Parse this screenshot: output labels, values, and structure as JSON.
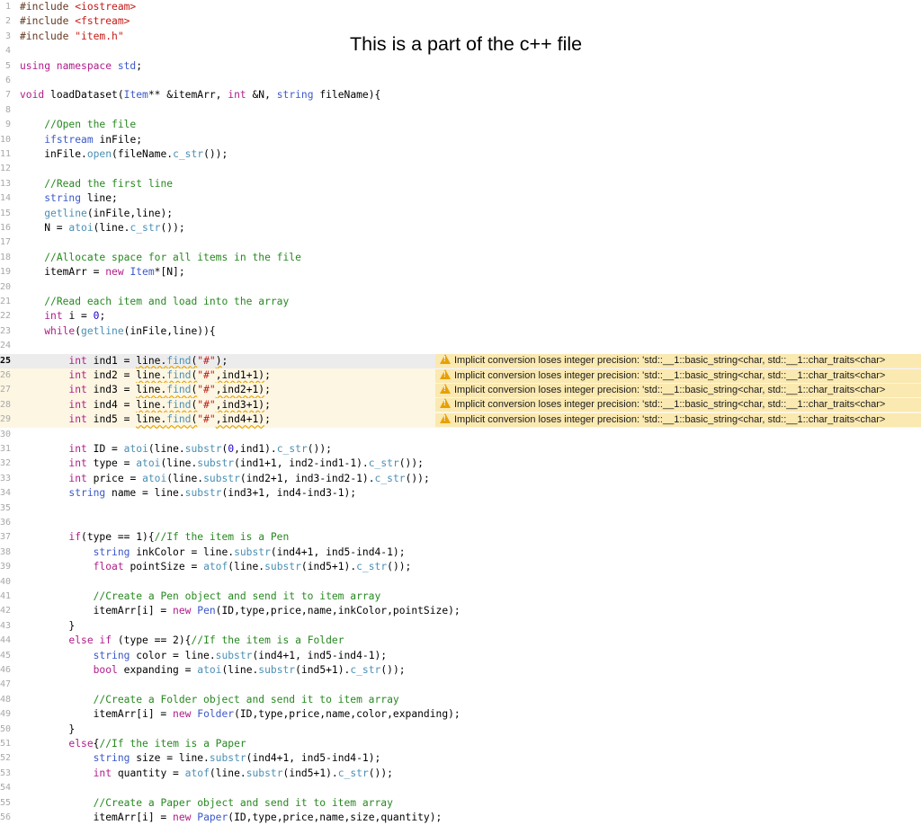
{
  "caption": "This is a part of the c++ file",
  "warning_text": "Implicit conversion loses integer precision: 'std::__1::basic_string<char, std::__1::char_traits<char>",
  "colors": {
    "keyword": "#b01c8a",
    "type": "#3b58c9",
    "function": "#4a8fb4",
    "comment": "#278820",
    "string": "#c41a16",
    "number": "#1c00cf",
    "warning_bg": "#fae9b0",
    "warning_icon": "#e8a000"
  },
  "lines": [
    {
      "n": "1",
      "tokens": [
        [
          "pp",
          "#include "
        ],
        [
          "st",
          "<iostream>"
        ]
      ]
    },
    {
      "n": "2",
      "tokens": [
        [
          "pp",
          "#include "
        ],
        [
          "st",
          "<fstream>"
        ]
      ]
    },
    {
      "n": "3",
      "tokens": [
        [
          "pp",
          "#include "
        ],
        [
          "st",
          "\"item.h\""
        ]
      ]
    },
    {
      "n": "4",
      "tokens": []
    },
    {
      "n": "5",
      "tokens": [
        [
          "kw",
          "using namespace "
        ],
        [
          "tp",
          "std"
        ],
        [
          "",
          "; "
        ]
      ]
    },
    {
      "n": "6",
      "tokens": []
    },
    {
      "n": "7",
      "tokens": [
        [
          "kw",
          "void "
        ],
        [
          "",
          "loadDataset("
        ],
        [
          "tp",
          "Item"
        ],
        [
          "",
          "** &itemArr, "
        ],
        [
          "kw",
          "int "
        ],
        [
          "",
          "&N, "
        ],
        [
          "tp",
          "string "
        ],
        [
          "",
          "fileName){"
        ]
      ]
    },
    {
      "n": "8",
      "tokens": []
    },
    {
      "n": "9",
      "tokens": [
        [
          "",
          "    "
        ],
        [
          "cm",
          "//Open the file"
        ]
      ]
    },
    {
      "n": "10",
      "tokens": [
        [
          "",
          "    "
        ],
        [
          "tp",
          "ifstream "
        ],
        [
          "",
          "inFile;"
        ]
      ]
    },
    {
      "n": "11",
      "tokens": [
        [
          "",
          "    inFile."
        ],
        [
          "fn",
          "open"
        ],
        [
          "",
          "(fileName."
        ],
        [
          "fn",
          "c_str"
        ],
        [
          "",
          "());"
        ]
      ]
    },
    {
      "n": "12",
      "tokens": []
    },
    {
      "n": "13",
      "tokens": [
        [
          "",
          "    "
        ],
        [
          "cm",
          "//Read the first line"
        ]
      ]
    },
    {
      "n": "14",
      "tokens": [
        [
          "",
          "    "
        ],
        [
          "tp",
          "string "
        ],
        [
          "",
          "line;"
        ]
      ]
    },
    {
      "n": "15",
      "tokens": [
        [
          "",
          "    "
        ],
        [
          "fn",
          "getline"
        ],
        [
          "",
          "(inFile,line);"
        ]
      ]
    },
    {
      "n": "16",
      "tokens": [
        [
          "",
          "    N = "
        ],
        [
          "fn",
          "atoi"
        ],
        [
          "",
          "(line."
        ],
        [
          "fn",
          "c_str"
        ],
        [
          "",
          "());"
        ]
      ]
    },
    {
      "n": "17",
      "tokens": []
    },
    {
      "n": "18",
      "tokens": [
        [
          "",
          "    "
        ],
        [
          "cm",
          "//Allocate space for all items in the file"
        ]
      ]
    },
    {
      "n": "19",
      "tokens": [
        [
          "",
          "    itemArr = "
        ],
        [
          "kw",
          "new "
        ],
        [
          "tp",
          "Item"
        ],
        [
          "",
          "*[N];"
        ]
      ]
    },
    {
      "n": "20",
      "tokens": []
    },
    {
      "n": "21",
      "tokens": [
        [
          "",
          "    "
        ],
        [
          "cm",
          "//Read each item and load into the array"
        ]
      ]
    },
    {
      "n": "22",
      "tokens": [
        [
          "",
          "    "
        ],
        [
          "kw",
          "int "
        ],
        [
          "",
          "i = "
        ],
        [
          "nm",
          "0"
        ],
        [
          "",
          ";"
        ]
      ]
    },
    {
      "n": "23",
      "tokens": [
        [
          "",
          "    "
        ],
        [
          "kw",
          "while"
        ],
        [
          "",
          "("
        ],
        [
          "fn",
          "getline"
        ],
        [
          "",
          "(inFile,line)){"
        ]
      ]
    },
    {
      "n": "24",
      "tokens": []
    },
    {
      "n": "25",
      "cur": true,
      "warn": true,
      "tokens": [
        [
          "",
          "        "
        ],
        [
          "kw",
          "int "
        ],
        [
          "",
          "ind1 = "
        ],
        [
          "u",
          "line."
        ],
        [
          "fnu",
          "find"
        ],
        [
          "u",
          "("
        ],
        [
          "st",
          "\"#\""
        ],
        [
          "u",
          ")"
        ],
        [
          "",
          ";"
        ]
      ]
    },
    {
      "n": "26",
      "warn": true,
      "tokens": [
        [
          "",
          "        "
        ],
        [
          "kw",
          "int "
        ],
        [
          "",
          "ind2 = "
        ],
        [
          "u",
          "line."
        ],
        [
          "fnu",
          "find"
        ],
        [
          "u",
          "("
        ],
        [
          "st",
          "\"#\""
        ],
        [
          "u",
          ",ind1+1)"
        ],
        [
          "",
          ";"
        ]
      ]
    },
    {
      "n": "27",
      "warn": true,
      "tokens": [
        [
          "",
          "        "
        ],
        [
          "kw",
          "int "
        ],
        [
          "",
          "ind3 = "
        ],
        [
          "u",
          "line."
        ],
        [
          "fnu",
          "find"
        ],
        [
          "u",
          "("
        ],
        [
          "st",
          "\"#\""
        ],
        [
          "u",
          ",ind2+1)"
        ],
        [
          "",
          ";"
        ]
      ]
    },
    {
      "n": "28",
      "warn": true,
      "tokens": [
        [
          "",
          "        "
        ],
        [
          "kw",
          "int "
        ],
        [
          "",
          "ind4 = "
        ],
        [
          "u",
          "line."
        ],
        [
          "fnu",
          "find"
        ],
        [
          "u",
          "("
        ],
        [
          "st",
          "\"#\""
        ],
        [
          "u",
          ",ind3+1)"
        ],
        [
          "",
          ";"
        ]
      ]
    },
    {
      "n": "29",
      "warn": true,
      "tokens": [
        [
          "",
          "        "
        ],
        [
          "kw",
          "int "
        ],
        [
          "",
          "ind5 = "
        ],
        [
          "u",
          "line."
        ],
        [
          "fnu",
          "find"
        ],
        [
          "u",
          "("
        ],
        [
          "st",
          "\"#\""
        ],
        [
          "u",
          ",ind4+1)"
        ],
        [
          "",
          ";"
        ]
      ]
    },
    {
      "n": "30",
      "tokens": []
    },
    {
      "n": "31",
      "tokens": [
        [
          "",
          "        "
        ],
        [
          "kw",
          "int "
        ],
        [
          "",
          "ID = "
        ],
        [
          "fn",
          "atoi"
        ],
        [
          "",
          "(line."
        ],
        [
          "fn",
          "substr"
        ],
        [
          "",
          "("
        ],
        [
          "nm",
          "0"
        ],
        [
          "",
          ",ind1)."
        ],
        [
          "fn",
          "c_str"
        ],
        [
          "",
          "());"
        ]
      ]
    },
    {
      "n": "32",
      "tokens": [
        [
          "",
          "        "
        ],
        [
          "kw",
          "int "
        ],
        [
          "",
          "type = "
        ],
        [
          "fn",
          "atoi"
        ],
        [
          "",
          "(line."
        ],
        [
          "fn",
          "substr"
        ],
        [
          "",
          "(ind1+1, ind2-ind1-1)."
        ],
        [
          "fn",
          "c_str"
        ],
        [
          "",
          "());"
        ]
      ]
    },
    {
      "n": "33",
      "tokens": [
        [
          "",
          "        "
        ],
        [
          "kw",
          "int "
        ],
        [
          "",
          "price = "
        ],
        [
          "fn",
          "atoi"
        ],
        [
          "",
          "(line."
        ],
        [
          "fn",
          "substr"
        ],
        [
          "",
          "(ind2+1, ind3-ind2-1)."
        ],
        [
          "fn",
          "c_str"
        ],
        [
          "",
          "());"
        ]
      ]
    },
    {
      "n": "34",
      "tokens": [
        [
          "",
          "        "
        ],
        [
          "tp",
          "string "
        ],
        [
          "",
          "name = line."
        ],
        [
          "fn",
          "substr"
        ],
        [
          "",
          "(ind3+1, ind4-ind3-1);"
        ]
      ]
    },
    {
      "n": "35",
      "tokens": []
    },
    {
      "n": "36",
      "tokens": []
    },
    {
      "n": "37",
      "tokens": [
        [
          "",
          "        "
        ],
        [
          "kw",
          "if"
        ],
        [
          "",
          "(type == 1){"
        ],
        [
          "cm",
          "//If the item is a Pen"
        ]
      ]
    },
    {
      "n": "38",
      "tokens": [
        [
          "",
          "            "
        ],
        [
          "tp",
          "string "
        ],
        [
          "",
          "inkColor = line."
        ],
        [
          "fn",
          "substr"
        ],
        [
          "",
          "(ind4+1, ind5-ind4-1);"
        ]
      ]
    },
    {
      "n": "39",
      "tokens": [
        [
          "",
          "            "
        ],
        [
          "kw",
          "float "
        ],
        [
          "",
          "pointSize = "
        ],
        [
          "fn",
          "atof"
        ],
        [
          "",
          "(line."
        ],
        [
          "fn",
          "substr"
        ],
        [
          "",
          "(ind5+1)."
        ],
        [
          "fn",
          "c_str"
        ],
        [
          "",
          "());"
        ]
      ]
    },
    {
      "n": "40",
      "tokens": []
    },
    {
      "n": "41",
      "tokens": [
        [
          "",
          "            "
        ],
        [
          "cm",
          "//Create a Pen object and send it to item array"
        ]
      ]
    },
    {
      "n": "42",
      "tokens": [
        [
          "",
          "            itemArr[i] = "
        ],
        [
          "kw",
          "new "
        ],
        [
          "tp",
          "Pen"
        ],
        [
          "",
          "(ID,type,price,name,inkColor,pointSize);"
        ]
      ]
    },
    {
      "n": "43",
      "tokens": [
        [
          "",
          "        }"
        ]
      ]
    },
    {
      "n": "44",
      "tokens": [
        [
          "",
          "        "
        ],
        [
          "kw",
          "else if "
        ],
        [
          "",
          "(type == 2){"
        ],
        [
          "cm",
          "//If the item is a Folder"
        ]
      ]
    },
    {
      "n": "45",
      "tokens": [
        [
          "",
          "            "
        ],
        [
          "tp",
          "string "
        ],
        [
          "",
          "color = line."
        ],
        [
          "fn",
          "substr"
        ],
        [
          "",
          "(ind4+1, ind5-ind4-1);"
        ]
      ]
    },
    {
      "n": "46",
      "tokens": [
        [
          "",
          "            "
        ],
        [
          "kw",
          "bool "
        ],
        [
          "",
          "expanding = "
        ],
        [
          "fn",
          "atoi"
        ],
        [
          "",
          "(line."
        ],
        [
          "fn",
          "substr"
        ],
        [
          "",
          "(ind5+1)."
        ],
        [
          "fn",
          "c_str"
        ],
        [
          "",
          "());"
        ]
      ]
    },
    {
      "n": "47",
      "tokens": []
    },
    {
      "n": "48",
      "tokens": [
        [
          "",
          "            "
        ],
        [
          "cm",
          "//Create a Folder object and send it to item array"
        ]
      ]
    },
    {
      "n": "49",
      "tokens": [
        [
          "",
          "            itemArr[i] = "
        ],
        [
          "kw",
          "new "
        ],
        [
          "tp",
          "Folder"
        ],
        [
          "",
          "(ID,type,price,name,color,expanding);"
        ]
      ]
    },
    {
      "n": "50",
      "tokens": [
        [
          "",
          "        }"
        ]
      ]
    },
    {
      "n": "51",
      "tokens": [
        [
          "",
          "        "
        ],
        [
          "kw",
          "else"
        ],
        [
          "",
          "{"
        ],
        [
          "cm",
          "//If the item is a Paper"
        ]
      ]
    },
    {
      "n": "52",
      "tokens": [
        [
          "",
          "            "
        ],
        [
          "tp",
          "string "
        ],
        [
          "",
          "size = line."
        ],
        [
          "fn",
          "substr"
        ],
        [
          "",
          "(ind4+1, ind5-ind4-1);"
        ]
      ]
    },
    {
      "n": "53",
      "tokens": [
        [
          "",
          "            "
        ],
        [
          "kw",
          "int "
        ],
        [
          "",
          "quantity = "
        ],
        [
          "fn",
          "atof"
        ],
        [
          "",
          "(line."
        ],
        [
          "fn",
          "substr"
        ],
        [
          "",
          "(ind5+1)."
        ],
        [
          "fn",
          "c_str"
        ],
        [
          "",
          "());"
        ]
      ]
    },
    {
      "n": "54",
      "tokens": []
    },
    {
      "n": "55",
      "tokens": [
        [
          "",
          "            "
        ],
        [
          "cm",
          "//Create a Paper object and send it to item array"
        ]
      ]
    },
    {
      "n": "56",
      "tokens": [
        [
          "",
          "            itemArr[i] = "
        ],
        [
          "kw",
          "new "
        ],
        [
          "tp",
          "Paper"
        ],
        [
          "",
          "(ID,type,price,name,size,quantity);"
        ]
      ]
    }
  ]
}
